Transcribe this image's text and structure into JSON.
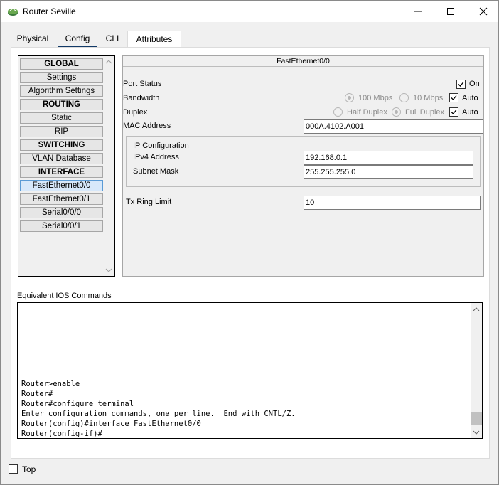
{
  "window": {
    "title": "Router Seville",
    "controls": [
      "minimize-icon",
      "maximize-icon",
      "close-icon"
    ]
  },
  "tabs": [
    {
      "label": "Physical",
      "active": false
    },
    {
      "label": "Config",
      "active": true
    },
    {
      "label": "CLI",
      "active": false
    },
    {
      "label": "Attributes",
      "active": false
    }
  ],
  "sidebar": {
    "items": [
      {
        "label": "GLOBAL",
        "type": "header"
      },
      {
        "label": "Settings",
        "type": "item"
      },
      {
        "label": "Algorithm Settings",
        "type": "item"
      },
      {
        "label": "ROUTING",
        "type": "header"
      },
      {
        "label": "Static",
        "type": "item"
      },
      {
        "label": "RIP",
        "type": "item"
      },
      {
        "label": "SWITCHING",
        "type": "header"
      },
      {
        "label": "VLAN Database",
        "type": "item"
      },
      {
        "label": "INTERFACE",
        "type": "header"
      },
      {
        "label": "FastEthernet0/0",
        "type": "item",
        "selected": true
      },
      {
        "label": "FastEthernet0/1",
        "type": "item"
      },
      {
        "label": "Serial0/0/0",
        "type": "item"
      },
      {
        "label": "Serial0/0/1",
        "type": "item"
      }
    ]
  },
  "interface": {
    "title": "FastEthernet0/0",
    "port_status": {
      "label": "Port Status",
      "on_label": "On",
      "checked": true
    },
    "bandwidth": {
      "label": "Bandwidth",
      "options": [
        "100 Mbps",
        "10 Mbps"
      ],
      "selected": "100 Mbps",
      "auto_label": "Auto",
      "auto_checked": true
    },
    "duplex": {
      "label": "Duplex",
      "options": [
        "Half Duplex",
        "Full Duplex"
      ],
      "selected": "Full Duplex",
      "auto_label": "Auto",
      "auto_checked": true
    },
    "mac": {
      "label": "MAC Address",
      "value": "000A.4102.A001"
    },
    "ip_config": {
      "title": "IP Configuration",
      "ipv4_label": "IPv4 Address",
      "ipv4_value": "192.168.0.1",
      "mask_label": "Subnet Mask",
      "mask_value": "255.255.255.0"
    },
    "tx_ring": {
      "label": "Tx Ring Limit",
      "value": "10"
    }
  },
  "console": {
    "label": "Equivalent IOS Commands",
    "lines": [
      "Router>enable",
      "Router#",
      "Router#configure terminal",
      "Enter configuration commands, one per line.  End with CNTL/Z.",
      "Router(config)#interface FastEthernet0/0",
      "Router(config-if)#"
    ]
  },
  "footer": {
    "top_label": "Top",
    "top_checked": false
  },
  "colors": {
    "accent": "#123a68",
    "selection": "#d7e8fa"
  }
}
